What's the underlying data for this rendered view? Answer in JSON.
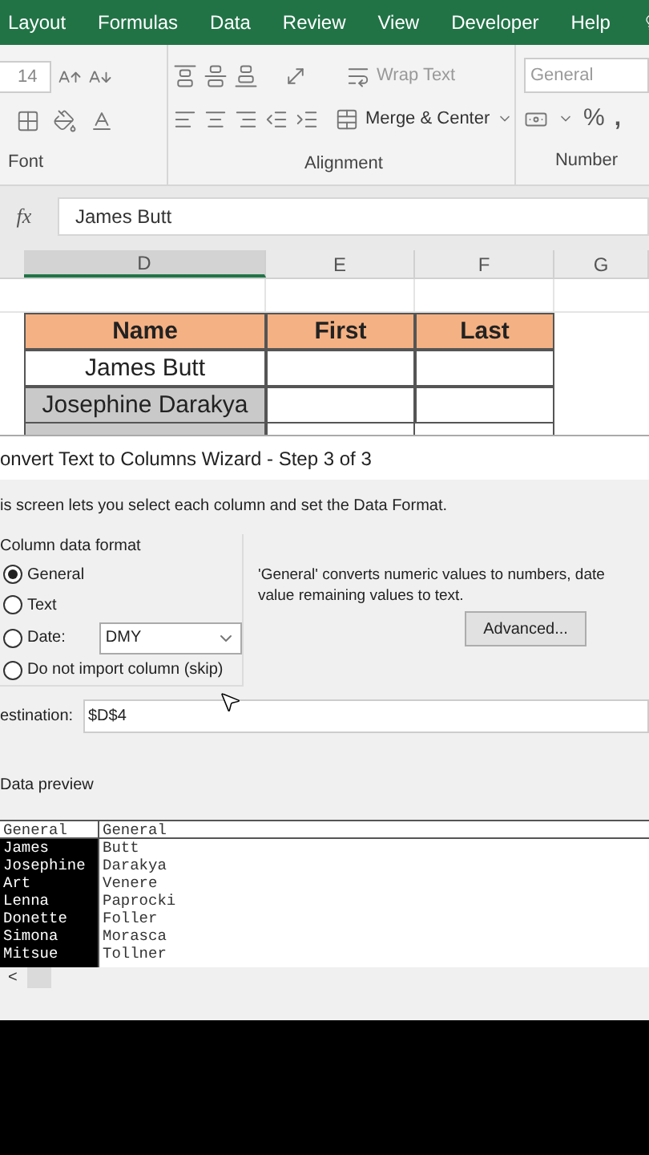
{
  "ribbon_tabs": [
    {
      "label": "Layout",
      "selected": false
    },
    {
      "label": "Formulas",
      "selected": false
    },
    {
      "label": "Data",
      "selected": false
    },
    {
      "label": "Review",
      "selected": false
    },
    {
      "label": "View",
      "selected": false
    },
    {
      "label": "Developer",
      "selected": false
    },
    {
      "label": "Help",
      "selected": false
    }
  ],
  "ribbon": {
    "font_size": "14",
    "wrap_text": "Wrap Text",
    "merge_center": "Merge & Center",
    "number_format": "General",
    "percent": "%",
    "comma": ",",
    "groups": [
      "Font",
      "Alignment",
      "Number"
    ]
  },
  "formula_bar": {
    "fx": "fx",
    "value": "James Butt"
  },
  "sheet": {
    "columns": [
      {
        "label": "D",
        "selected": true
      },
      {
        "label": "E",
        "selected": false
      },
      {
        "label": "F",
        "selected": false
      },
      {
        "label": "G",
        "selected": false
      }
    ],
    "header": [
      "Name",
      "First",
      "Last"
    ],
    "rows": [
      {
        "name": "James Butt",
        "selected": false
      },
      {
        "name": "Josephine Darakya",
        "selected": true
      }
    ]
  },
  "dialog": {
    "title": "onvert Text to Columns Wizard - Step 3 of 3",
    "intro": "is screen lets you select each column and set the Data Format.",
    "format_group": "Column data format",
    "options": [
      {
        "label": "General",
        "selected": true
      },
      {
        "label": "Text",
        "selected": false
      },
      {
        "label": "Date:",
        "selected": false
      },
      {
        "label": "Do not import column (skip)",
        "selected": false
      }
    ],
    "date_value": "DMY",
    "description": "'General' converts numeric values to numbers, date value remaining values to text.",
    "advanced": "Advanced...",
    "destination_label": "estination:",
    "destination": "$D$4",
    "preview_label": "Data preview",
    "preview_columns": [
      {
        "header": "General",
        "selected": true,
        "values": [
          "James",
          "Josephine",
          "Art",
          "Lenna",
          "Donette",
          "Simona",
          "Mitsue"
        ]
      },
      {
        "header": "General",
        "selected": false,
        "values": [
          "Butt",
          "Darakya",
          "Venere",
          "Paprocki",
          "Foller",
          "Morasca",
          "Tollner"
        ]
      }
    ],
    "scroll_left": "<"
  }
}
